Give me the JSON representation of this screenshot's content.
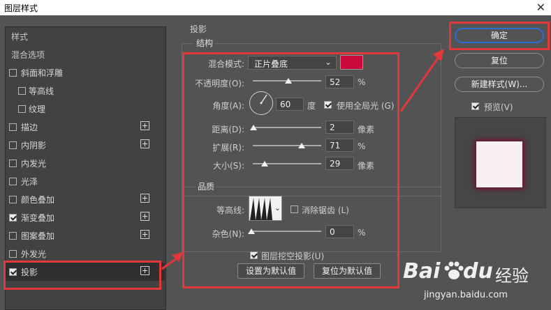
{
  "window": {
    "title": "图层样式",
    "close_glyph": "✕"
  },
  "sidebar": {
    "items": [
      {
        "label": "样式",
        "type": "header"
      },
      {
        "label": "混合选项",
        "type": "header"
      },
      {
        "label": "斜面和浮雕",
        "checked": false,
        "plus": false,
        "indent": false
      },
      {
        "label": "等高线",
        "checked": false,
        "plus": false,
        "indent": true
      },
      {
        "label": "纹理",
        "checked": false,
        "plus": false,
        "indent": true
      },
      {
        "label": "描边",
        "checked": false,
        "plus": true,
        "indent": false
      },
      {
        "label": "内阴影",
        "checked": false,
        "plus": true,
        "indent": false
      },
      {
        "label": "内发光",
        "checked": false,
        "plus": false,
        "indent": false
      },
      {
        "label": "光泽",
        "checked": false,
        "plus": false,
        "indent": false
      },
      {
        "label": "颜色叠加",
        "checked": false,
        "plus": true,
        "indent": false
      },
      {
        "label": "渐变叠加",
        "checked": true,
        "plus": true,
        "indent": false
      },
      {
        "label": "图案叠加",
        "checked": false,
        "plus": true,
        "indent": false
      },
      {
        "label": "外发光",
        "checked": false,
        "plus": false,
        "indent": false
      },
      {
        "label": "投影",
        "checked": true,
        "plus": true,
        "indent": false,
        "selected": true
      }
    ]
  },
  "drop_shadow": {
    "title": "投影",
    "structure": {
      "title": "结构",
      "blend_mode_label": "混合模式:",
      "blend_mode_value": "正片叠底",
      "blend_color": "#cc0a3c",
      "opacity_label": "不透明度(O):",
      "opacity_value": "52",
      "opacity_unit": "%",
      "opacity_fraction": 0.52,
      "angle_label": "角度(A):",
      "angle_value": "60",
      "angle_unit": "度",
      "global_light_label": "使用全局光 (G)",
      "global_light_checked": true,
      "distance_label": "距离(D):",
      "distance_value": "2",
      "distance_unit": "像素",
      "spread_label": "扩展(R):",
      "spread_value": "71",
      "spread_unit": "%",
      "size_label": "大小(S):",
      "size_value": "29",
      "size_unit": "像素"
    },
    "quality": {
      "title": "品质",
      "contour_label": "等高线:",
      "anti_alias_label": "消除锯齿 (L)",
      "anti_alias_checked": false,
      "noise_label": "杂色(N):",
      "noise_value": "0",
      "noise_unit": "%"
    },
    "knockout_label": "图层挖空投影(U)",
    "knockout_checked": true,
    "make_default_label": "设置为默认值",
    "reset_default_label": "复位为默认值"
  },
  "actions": {
    "ok_label": "确定",
    "reset_label": "复位",
    "new_style_label": "新建样式(W)...",
    "preview_label": "预览(V)",
    "preview_checked": true
  },
  "watermark": {
    "brand_text": "Bai",
    "brand_text2": "du",
    "cn_text": "经验",
    "url": "jingyan.baidu.com"
  },
  "colors": {
    "annotation_red": "#e3373a",
    "ok_border": "#2d6bd5",
    "shadow_color": "#cc0a3c"
  }
}
